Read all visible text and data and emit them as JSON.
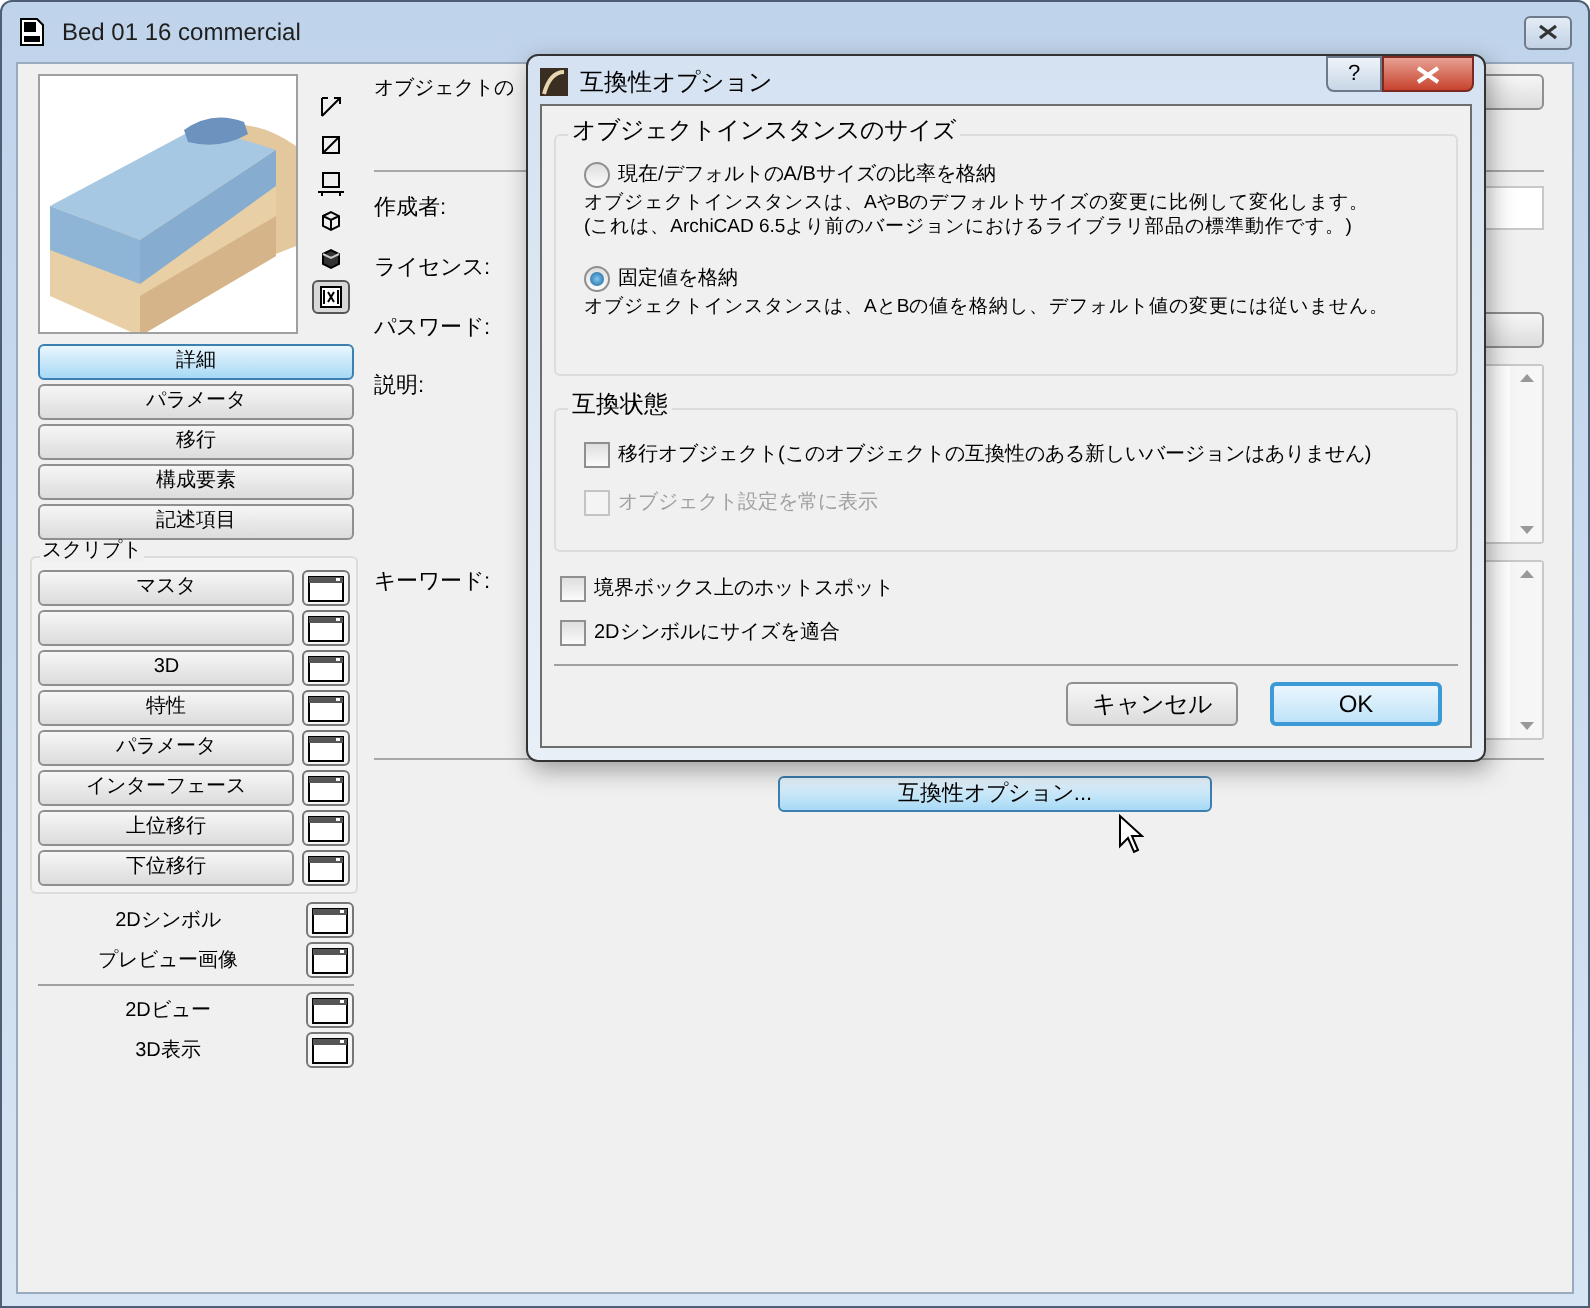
{
  "window": {
    "title": "Bed 01 16 commercial"
  },
  "sidebar": {
    "view_icons": [
      {
        "kind": "line",
        "selected": false
      },
      {
        "kind": "square",
        "selected": false
      },
      {
        "kind": "plan",
        "selected": false
      },
      {
        "kind": "wire",
        "selected": false
      },
      {
        "kind": "solid",
        "selected": false
      },
      {
        "kind": "film",
        "selected": true
      }
    ],
    "tabs": [
      {
        "label": "詳細",
        "selected": true
      },
      {
        "label": "パラメータ",
        "selected": false
      },
      {
        "label": "移行",
        "selected": false
      },
      {
        "label": "構成要素",
        "selected": false
      },
      {
        "label": "記述項目",
        "selected": false
      }
    ],
    "script_group": {
      "title": "スクリプト",
      "items": [
        {
          "kind": "labeled",
          "label": "マスタ"
        },
        {
          "kind": "blank"
        },
        {
          "kind": "labeled",
          "label": "3D"
        },
        {
          "kind": "labeled",
          "label": "特性"
        },
        {
          "kind": "labeled",
          "label": "パラメータ"
        },
        {
          "kind": "labeled",
          "label": "インターフェース"
        },
        {
          "kind": "labeled",
          "label": "上位移行"
        },
        {
          "kind": "labeled",
          "label": "下位移行"
        }
      ]
    },
    "extra_sections": [
      [
        {
          "label": "2Dシンボル"
        },
        {
          "label": "プレビュー画像"
        }
      ],
      [
        {
          "label": "2Dビュー"
        },
        {
          "label": "3D表示"
        }
      ]
    ]
  },
  "main": {
    "name_label": "オブジェクトの",
    "fields": [
      {
        "label": "作成者:",
        "kind": "text"
      },
      {
        "label": "ライセンス:",
        "kind": "none"
      },
      {
        "label": "パスワード:",
        "kind": "button"
      },
      {
        "label": "説明:",
        "kind": "textarea"
      },
      {
        "label": "キーワード:",
        "kind": "textarea"
      }
    ],
    "compat_button": "互換性オプション..."
  },
  "dialog": {
    "title": "互換性オプション",
    "help": "?",
    "size_group": {
      "title": "オブジェクトインスタンスのサイズ",
      "options": [
        {
          "label": "現在/デフォルトのA/Bサイズの比率を格納",
          "selected": false,
          "description": [
            "オブジェクトインスタンスは、AやBのデフォルトサイズの変更に比例して変化します。",
            "(これは、ArchiCAD 6.5より前のバージョンにおけるライブラリ部品の標準動作です。)"
          ]
        },
        {
          "label": "固定値を格納",
          "selected": true,
          "description": [
            "オブジェクトインスタンスは、AとBの値を格納し、デフォルト値の変更には従いません。"
          ]
        }
      ]
    },
    "compat_group": {
      "title": "互換状態",
      "checks": [
        {
          "label": "移行オブジェクト(このオブジェクトの互換性のある新しいバージョンはありません)",
          "checked": false,
          "disabled": false
        },
        {
          "label": "オブジェクト設定を常に表示",
          "checked": false,
          "disabled": true
        }
      ]
    },
    "checks": [
      {
        "label": "境界ボックス上のホットスポット",
        "checked": false,
        "disabled": false
      },
      {
        "label": "2Dシンボルにサイズを適合",
        "checked": false,
        "disabled": false
      }
    ],
    "buttons": [
      {
        "label": "キャンセル",
        "selected": false
      },
      {
        "label": "OK",
        "selected": true
      }
    ]
  }
}
